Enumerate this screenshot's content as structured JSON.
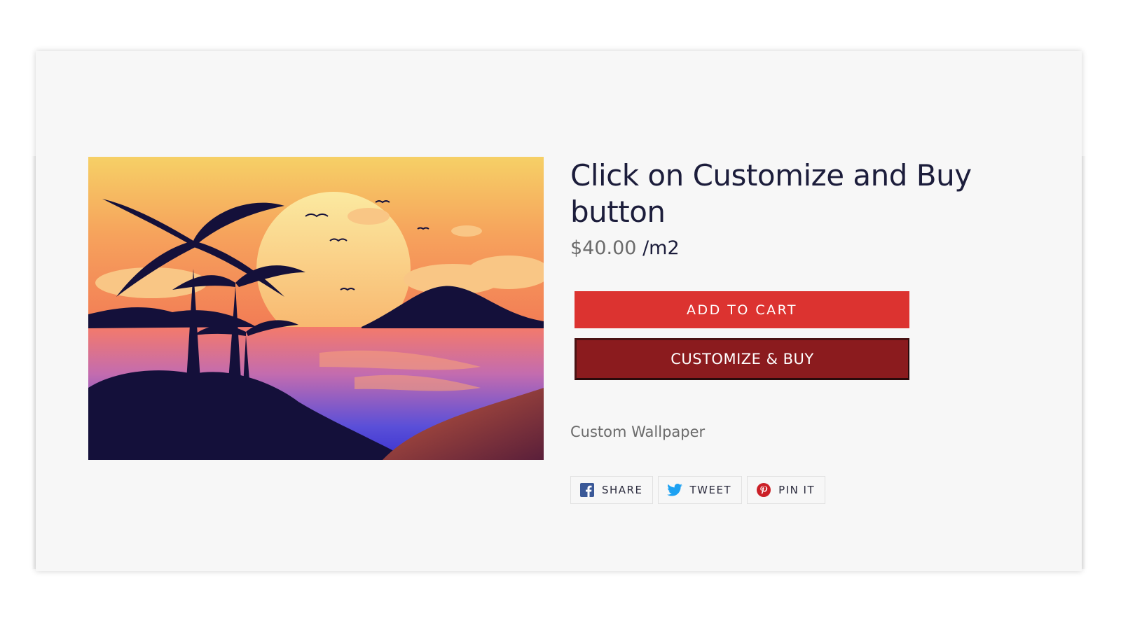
{
  "product": {
    "title": "Click on Customize and Buy button",
    "price": "$40.00",
    "unit": "/m2",
    "description": "Custom Wallpaper",
    "image_icon": "tropical-sunset-image"
  },
  "buttons": {
    "add_to_cart": "ADD TO CART",
    "customize_buy": "CUSTOMIZE & BUY"
  },
  "share": [
    {
      "label": "SHARE",
      "icon": "facebook-icon"
    },
    {
      "label": "TWEET",
      "icon": "twitter-icon"
    },
    {
      "label": "PIN IT",
      "icon": "pinterest-icon"
    }
  ],
  "colors": {
    "add_to_cart": "#dc3330",
    "customize_buy": "#8b1b1e",
    "title": "#1c1d3b",
    "facebook": "#3b5998",
    "twitter": "#1da1f2",
    "pinterest": "#cb2027"
  }
}
